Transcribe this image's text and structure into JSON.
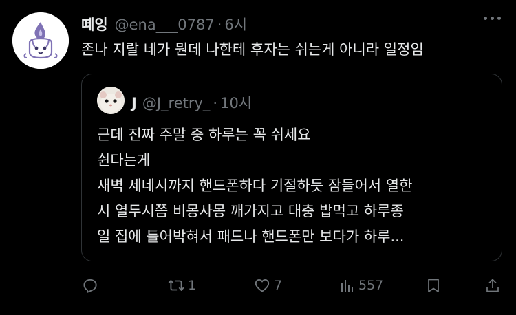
{
  "tweet": {
    "display_name": "떼잉",
    "handle": "@ena___0787",
    "separator": "·",
    "time": "6시",
    "text": "존나 지랄 네가 뭔데 나한테 후자는 쉬는게 아니라 일정임"
  },
  "quoted": {
    "display_name": "J",
    "handle": "@J_retry_",
    "separator": "·",
    "time": "10시",
    "lines": [
      "근데 진짜 주말 중 하루는 꼭 쉬세요",
      "쉰다는게",
      "새벽 세네시까지 핸드폰하다 기절하듯 잠들어서 열한",
      "시 열두시쯤 비몽사몽 깨가지고 대충 밥먹고 하루종",
      "일 집에 틀어박혀서 패드나 핸드폰만 보다가 하루..."
    ]
  },
  "actions": {
    "reply_icon": "reply-icon",
    "retweet_icon": "retweet-icon",
    "retweet_count": "1",
    "like_icon": "heart-icon",
    "like_count": "7",
    "views_icon": "bar-chart-icon",
    "views_count": "557",
    "bookmark_icon": "bookmark-icon",
    "share_icon": "share-icon"
  },
  "colors": {
    "background": "#000000",
    "text_primary": "#e7e9ea",
    "text_secondary": "#71767b",
    "border": "#2f3336"
  }
}
